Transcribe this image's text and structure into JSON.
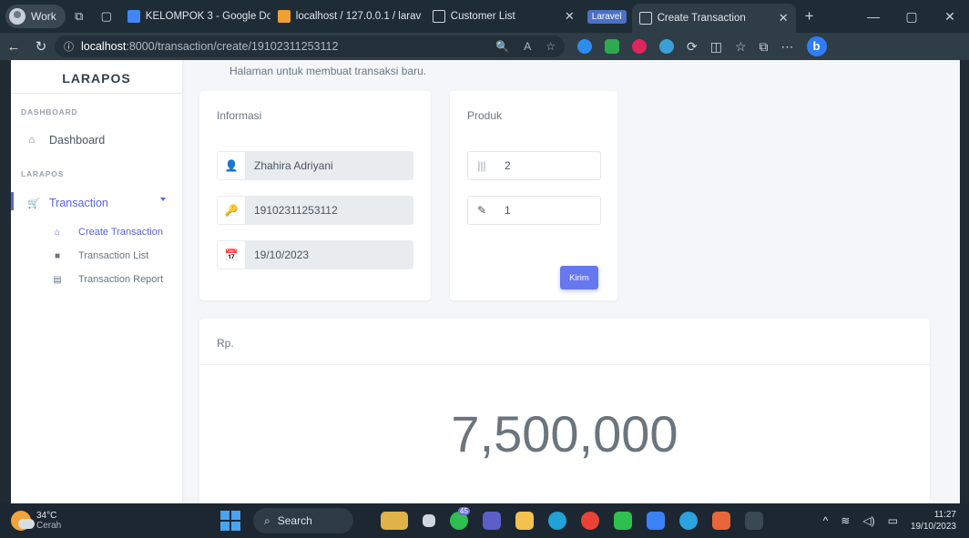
{
  "browser": {
    "profile": "Work",
    "tabs": [
      {
        "title": "KELOMPOK 3 - Google Do"
      },
      {
        "title": "localhost / 127.0.0.1 / larav"
      },
      {
        "title": "Customer List"
      },
      {
        "title": "Create Transaction"
      }
    ],
    "group_badge": "Laravel",
    "url_host": "localhost",
    "url_path": ":8000/transaction/create/19102311253112"
  },
  "app": {
    "brand": "LARAPOS",
    "sidebar": {
      "section_dashboard": "DASHBOARD",
      "dashboard_label": "Dashboard",
      "section_larapos": "LARAPOS",
      "transaction_label": "Transaction",
      "sub_items": [
        {
          "label": "Create Transaction"
        },
        {
          "label": "Transaction List"
        },
        {
          "label": "Transaction Report"
        }
      ]
    },
    "subtitle": "Halaman untuk membuat transaksi baru.",
    "informasi": {
      "title": "Informasi",
      "customer_name": "Zhahira Adriyani",
      "transaction_code": "19102311253112",
      "date": "19/10/2023"
    },
    "produk": {
      "title": "Produk",
      "product_value": "2",
      "quantity_value": "1",
      "submit_label": "Kirim"
    },
    "total": {
      "label": "Rp.",
      "value": "7,500,000"
    }
  },
  "taskbar": {
    "temperature": "34°C",
    "condition": "Cerah",
    "search_label": "Search",
    "time": "11:27",
    "date": "19/10/2023",
    "badge_count": "45"
  },
  "colors": {
    "accent": "#6777ef",
    "sidebar_active": "#5b65d8",
    "chrome_dark": "#1e2c36"
  }
}
